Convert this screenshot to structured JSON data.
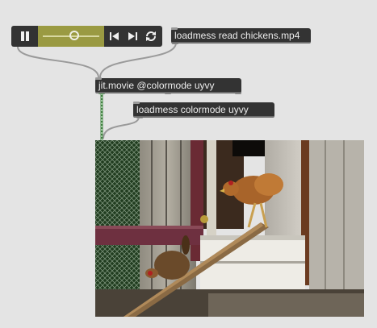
{
  "patch": {
    "loadmess_read": "loadmess read chickens.mp4",
    "jit_movie": "jit.movie @colormode uyvy",
    "loadmess_colormode": "loadmess colormode uyvy"
  },
  "playbar": {
    "play_state": "playing",
    "position": 0.55
  },
  "colors": {
    "object_bg": "#333333",
    "playbar_track": "#9a9a42",
    "matrix_cord": "#5f9f5f",
    "patch_bg": "#e4e4e4"
  },
  "icons": [
    "pause-icon",
    "step-back-icon",
    "step-forward-icon",
    "loop-icon"
  ]
}
